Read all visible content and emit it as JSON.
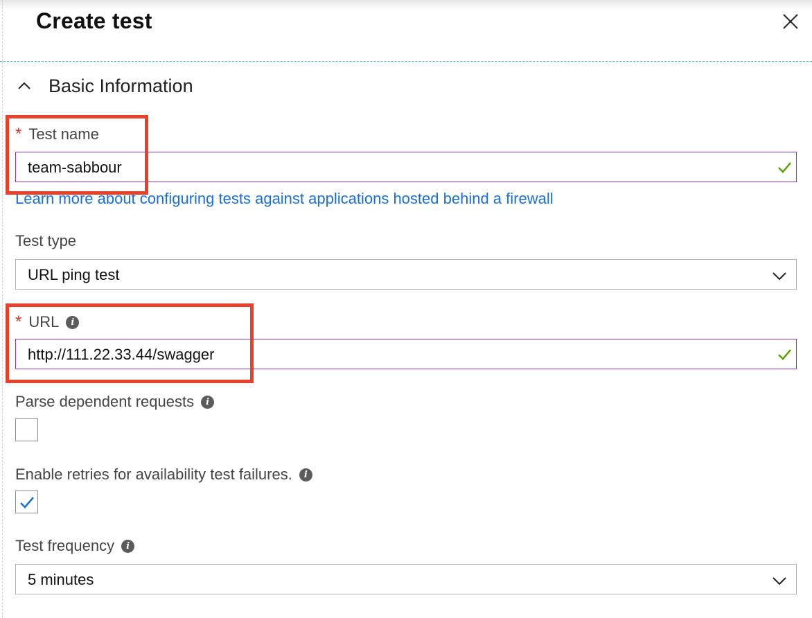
{
  "panel": {
    "title": "Create test",
    "close_icon": "close-icon"
  },
  "section": {
    "title": "Basic Information",
    "toggle_icon": "chevron-up-icon"
  },
  "fields": {
    "required_marker": "*",
    "info_glyph": "i",
    "test_name": {
      "label": "Test name",
      "value": "team-sabbour",
      "valid_icon": "checkmark-icon"
    },
    "firewall_link": "Learn more about configuring tests against applications hosted behind a firewall",
    "test_type": {
      "label": "Test type",
      "value": "URL ping test"
    },
    "url": {
      "label": "URL",
      "value": "http://111.22.33.44/swagger",
      "valid_icon": "checkmark-icon"
    },
    "parse_dependent": {
      "label": "Parse dependent requests",
      "checked": false
    },
    "enable_retries": {
      "label": "Enable retries for availability test failures.",
      "checked": true
    },
    "test_frequency": {
      "label": "Test frequency",
      "value": "5 minutes"
    }
  },
  "colors": {
    "accent_link": "#1a6fd4",
    "input_border_focus": "#8a3ab9",
    "valid_check": "#57a300",
    "required_marker": "#d23a2b",
    "highlight_box": "#e8402a",
    "divider": "#3aa7dc",
    "checkbox_check": "#1a6fd4"
  }
}
